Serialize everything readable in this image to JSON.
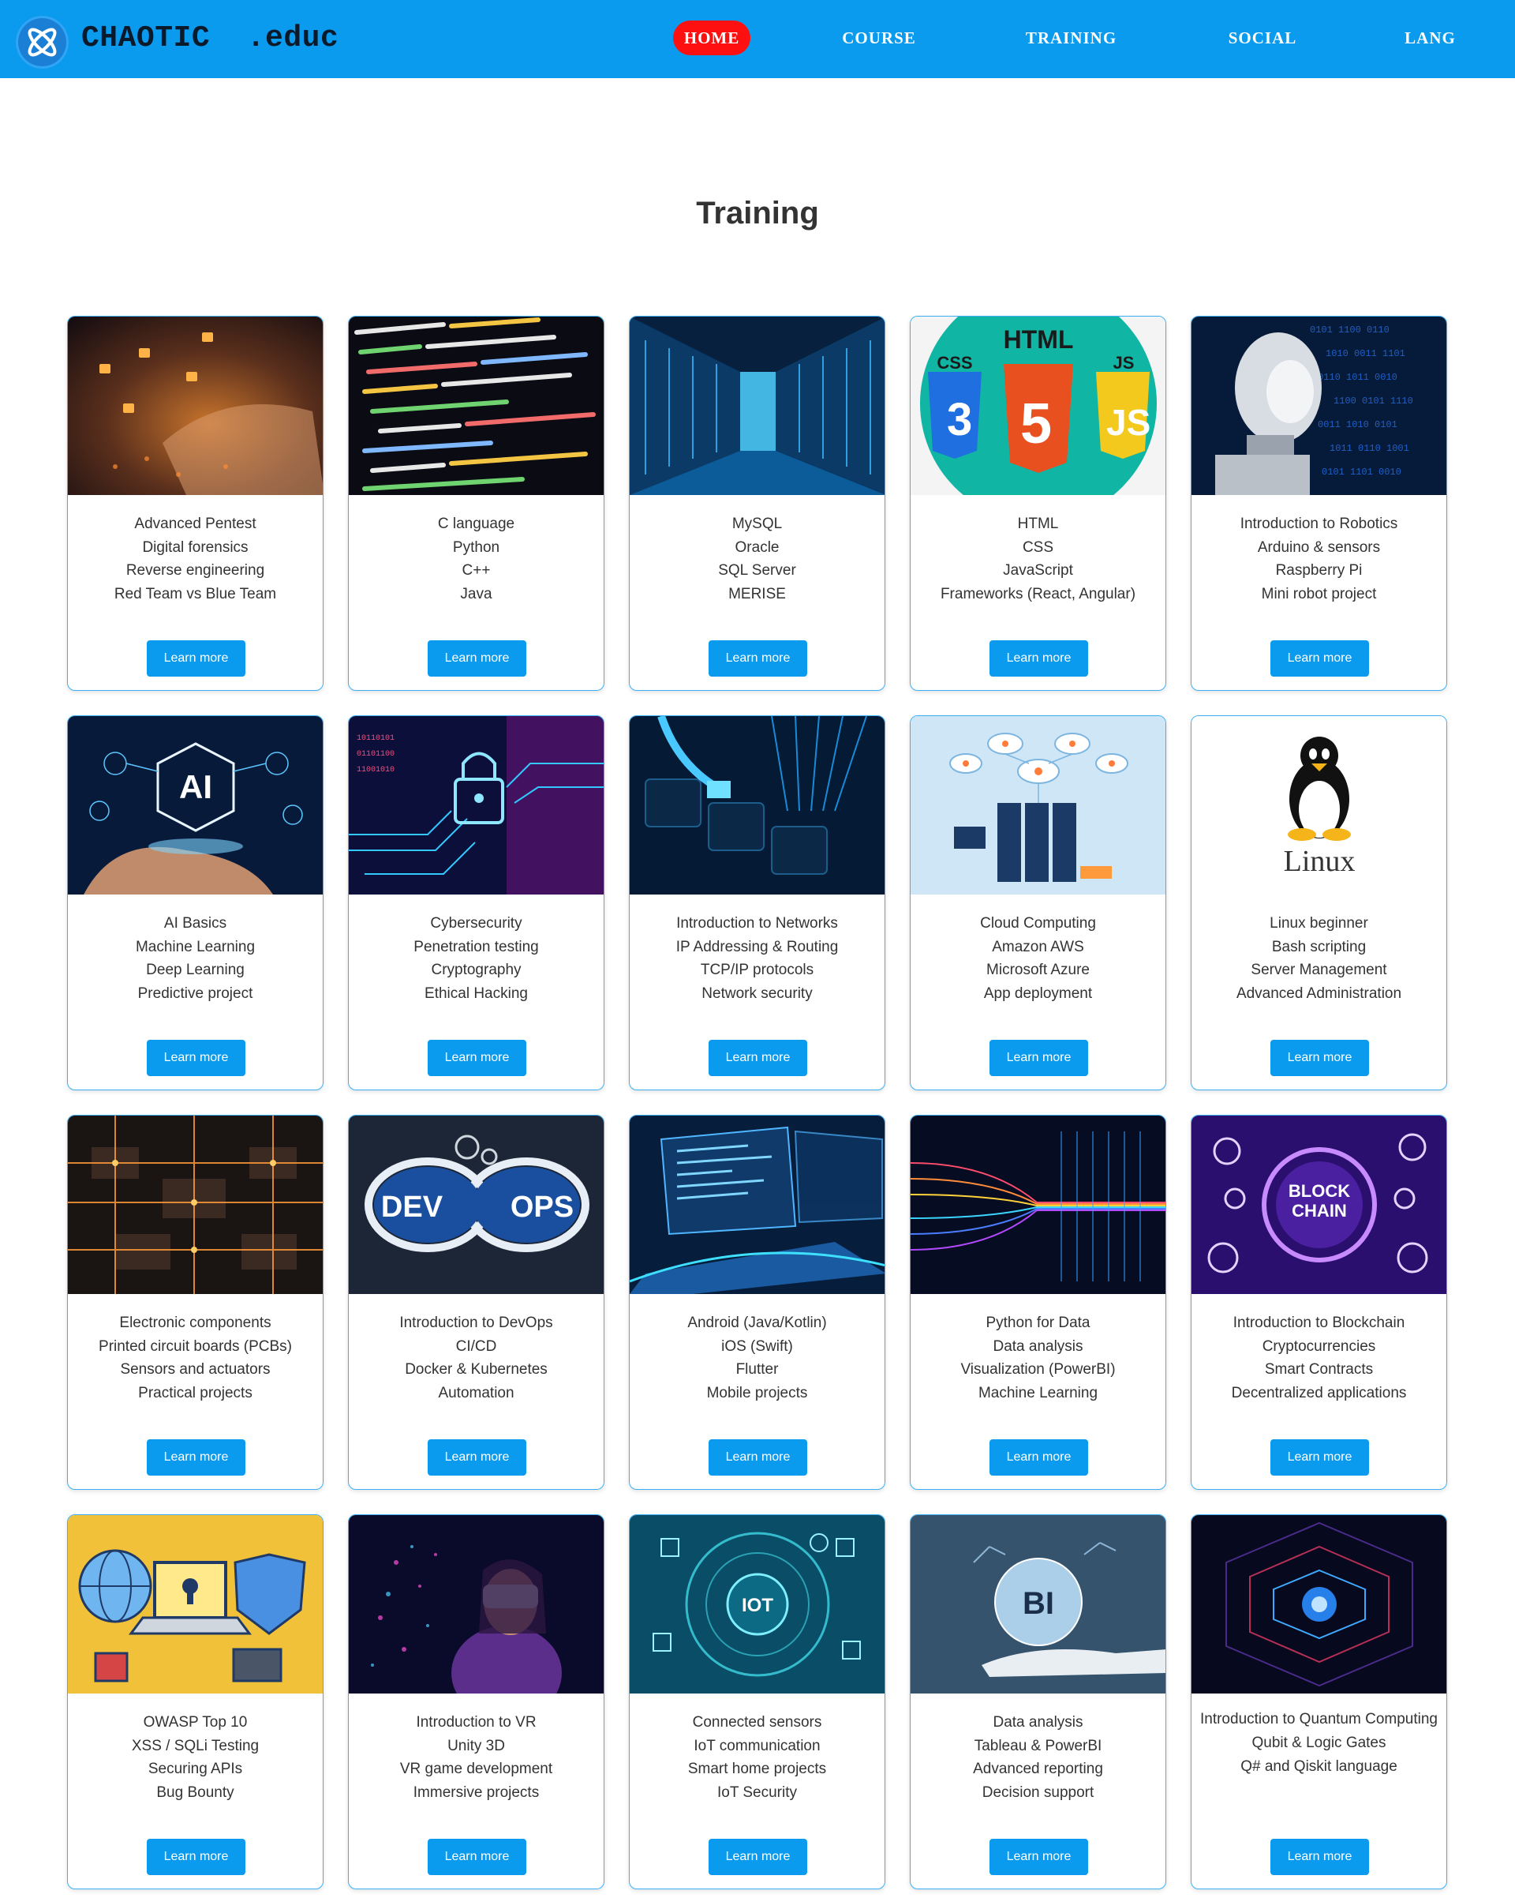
{
  "header": {
    "brand": "CHAOTIC  .educ",
    "logo_icon": "atom-logo-icon",
    "nav": [
      {
        "label": "HOME",
        "active": true
      },
      {
        "label": "COURSE",
        "active": false
      },
      {
        "label": "TRAINING",
        "active": false
      },
      {
        "label": "SOCIAL",
        "active": false
      },
      {
        "label": "LANG",
        "active": false
      }
    ]
  },
  "page_title": "Training",
  "colors": {
    "accent": "#0a9bef",
    "active_nav": "#ff1010",
    "card_border": "#3db0f5"
  },
  "cards": [
    {
      "image": "hacker-keyboard-locks",
      "lines": [
        "Advanced Pentest",
        "Digital forensics",
        "Reverse engineering",
        "Red Team vs Blue Team"
      ],
      "button": "Learn more"
    },
    {
      "image": "code-screen",
      "lines": [
        "C language",
        "Python",
        "C++",
        "Java"
      ],
      "button": "Learn more"
    },
    {
      "image": "server-room",
      "lines": [
        "MySQL",
        "Oracle",
        "SQL Server",
        "MERISE"
      ],
      "button": "Learn more"
    },
    {
      "image": "html-css-js-logos",
      "image_text": {
        "top": "HTML",
        "left": "CSS",
        "right": "JS"
      },
      "lines": [
        "HTML",
        "CSS",
        "JavaScript",
        "Frameworks (React, Angular)"
      ],
      "button": "Learn more"
    },
    {
      "image": "humanoid-robot",
      "lines": [
        "Introduction to Robotics",
        "Arduino & sensors",
        "Raspberry Pi",
        "Mini robot project"
      ],
      "button": "Learn more"
    },
    {
      "image": "ai-hand",
      "image_text": {
        "center": "AI"
      },
      "lines": [
        "AI Basics",
        "Machine Learning",
        "Deep Learning",
        "Predictive project"
      ],
      "button": "Learn more"
    },
    {
      "image": "circuit-padlock",
      "lines": [
        "Cybersecurity",
        "Penetration testing",
        "Cryptography",
        "Ethical Hacking"
      ],
      "button": "Learn more"
    },
    {
      "image": "network-cable-keyboard",
      "lines": [
        "Introduction to Networks",
        "IP Addressing & Routing",
        "TCP/IP protocols",
        "Network security"
      ],
      "button": "Learn more"
    },
    {
      "image": "cloud-servers",
      "lines": [
        "Cloud Computing",
        "Amazon AWS",
        "Microsoft Azure",
        "App deployment"
      ],
      "button": "Learn more"
    },
    {
      "image": "linux-tux",
      "image_text": {
        "center": "Linux"
      },
      "lines": [
        "Linux beginner",
        "Bash scripting",
        "Server Management",
        "Advanced Administration"
      ],
      "button": "Learn more"
    },
    {
      "image": "circuit-board",
      "lines": [
        "Electronic components",
        "Printed circuit boards (PCBs)",
        "Sensors and actuators",
        "Practical projects"
      ],
      "button": "Learn more"
    },
    {
      "image": "devops-infinity",
      "image_text": {
        "left": "DEV",
        "right": "OPS"
      },
      "lines": [
        "Introduction to DevOps",
        "CI/CD",
        "Docker & Kubernetes",
        "Automation"
      ],
      "button": "Learn more"
    },
    {
      "image": "laptop-code",
      "lines": [
        "Android (Java/Kotlin)",
        "iOS (Swift)",
        "Flutter",
        "Mobile projects"
      ],
      "button": "Learn more"
    },
    {
      "image": "data-streams",
      "lines": [
        "Python for Data",
        "Data analysis",
        "Visualization (PowerBI)",
        "Machine Learning"
      ],
      "button": "Learn more"
    },
    {
      "image": "blockchain-coins",
      "image_text": {
        "center_top": "BLOCK",
        "center_bottom": "CHAIN"
      },
      "lines": [
        "Introduction to Blockchain",
        "Cryptocurrencies",
        "Smart Contracts",
        "Decentralized applications"
      ],
      "button": "Learn more"
    },
    {
      "image": "security-laptop-shield",
      "lines": [
        "OWASP Top 10",
        "XSS / SQLi Testing",
        "Securing APIs",
        "Bug Bounty"
      ],
      "button": "Learn more"
    },
    {
      "image": "vr-headset-woman",
      "lines": [
        "Introduction to VR",
        "Unity 3D",
        "VR game development",
        "Immersive projects"
      ],
      "button": "Learn more"
    },
    {
      "image": "iot-circle",
      "image_text": {
        "center": "IOT"
      },
      "lines": [
        "Connected sensors",
        "IoT communication",
        "Smart home projects",
        "IoT Security"
      ],
      "button": "Learn more"
    },
    {
      "image": "bi-globe",
      "image_text": {
        "center": "BI"
      },
      "lines": [
        "Data analysis",
        "Tableau & PowerBI",
        "Advanced reporting",
        "Decision support"
      ],
      "button": "Learn more"
    },
    {
      "image": "quantum-tunnel",
      "lines": [
        "Introduction to Quantum Computing",
        "Qubit & Logic Gates",
        "Q# and Qiskit language"
      ],
      "button": "Learn more"
    }
  ]
}
